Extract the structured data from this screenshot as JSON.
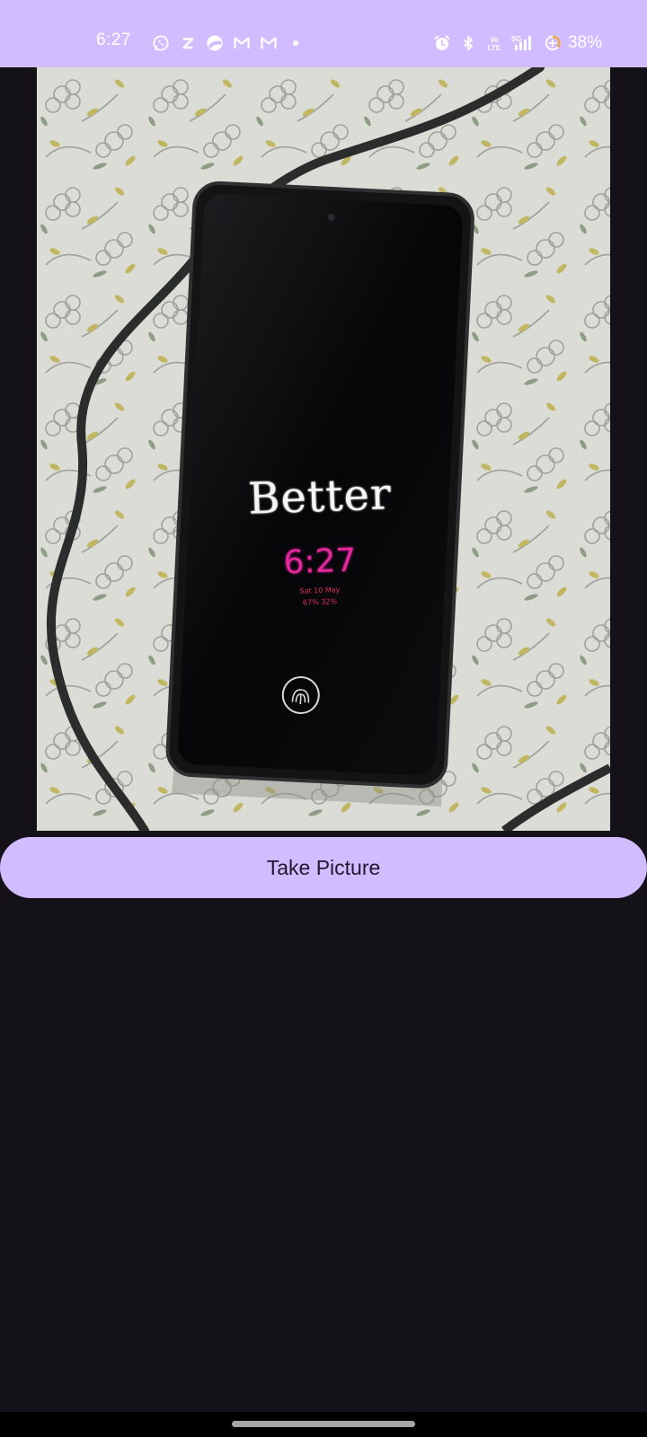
{
  "colors": {
    "accent": "#d0bcfe",
    "background": "#141218",
    "button_text": "#21182f"
  },
  "status_bar": {
    "time": "6:27",
    "left_icons": [
      "whatsapp-icon",
      "zomato-icon",
      "pie-app-icon",
      "gmail-icon",
      "gmail-icon",
      "more-notifications-dot-icon"
    ],
    "right_icons": [
      "alarm-icon",
      "bluetooth-icon",
      "volte-icon",
      "signal-5g-icon",
      "battery-saver-icon"
    ],
    "signal_label": "5G",
    "volte_label": "Vo LTE",
    "battery": "38%"
  },
  "preview": {
    "lock_screen_word": "Better",
    "lock_screen_time": "6:27",
    "lock_screen_date": "Sat 10 May",
    "lock_screen_battery": "67% 32%"
  },
  "actions": {
    "take_picture": "Take Picture"
  }
}
